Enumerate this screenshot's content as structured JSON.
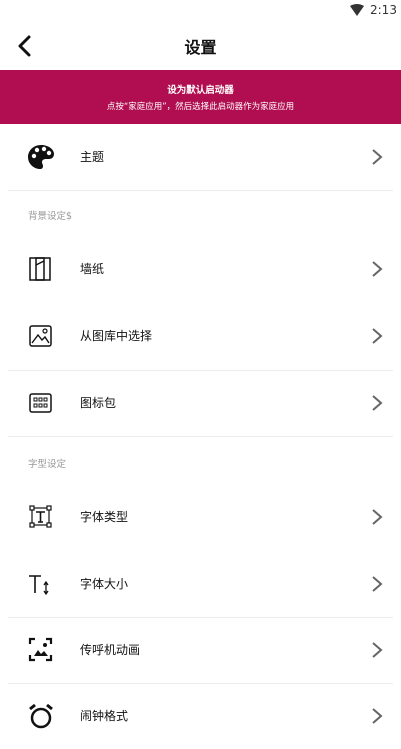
{
  "status": {
    "time": "2:13",
    "wifi_icon": "wifi-icon"
  },
  "header": {
    "title": "设置",
    "back_icon": "back-arrow-icon"
  },
  "banner": {
    "title": "设为默认启动器",
    "subtitle": "点按“家庭应用”，然后选择此启动器作为家庭应用",
    "color": "#b00e50"
  },
  "sections": {
    "background": "背景设定$",
    "font": "字型设定"
  },
  "items": [
    {
      "label": "主题",
      "icon": "palette-icon"
    },
    {
      "label": "墙纸",
      "icon": "wallpaper-icon"
    },
    {
      "label": "从图库中选择",
      "icon": "gallery-icon"
    },
    {
      "label": "图标包",
      "icon": "icon-pack-icon"
    },
    {
      "label": "字体类型",
      "icon": "font-type-icon"
    },
    {
      "label": "字体大小",
      "icon": "font-size-icon"
    },
    {
      "label": "传呼机动画",
      "icon": "pager-animation-icon"
    },
    {
      "label": "闹钟格式",
      "icon": "alarm-clock-icon"
    }
  ]
}
